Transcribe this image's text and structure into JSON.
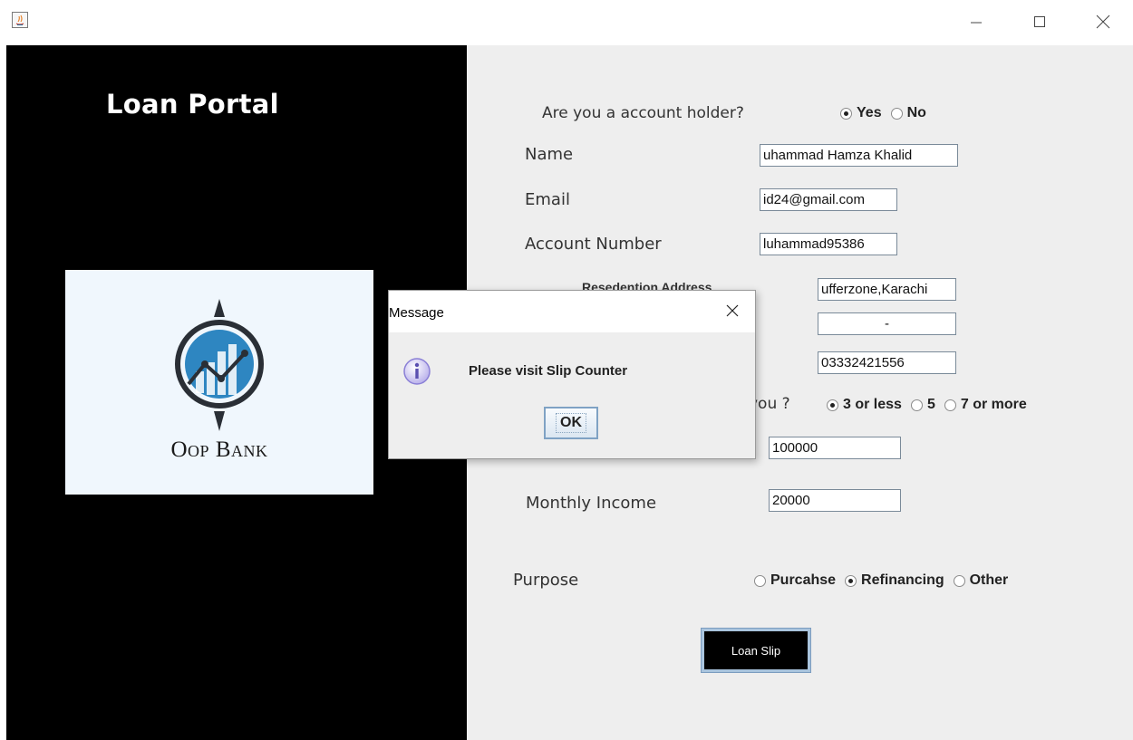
{
  "window": {
    "minimize_icon": "minimize-icon",
    "maximize_icon": "maximize-icon",
    "close_icon": "close-icon"
  },
  "brand": {
    "title": "Loan Portal",
    "logo_text": "Oop Bank",
    "logo_colors": [
      "#2a2f36",
      "#2e86c1",
      "#5fb0e5"
    ]
  },
  "form": {
    "account_holder": {
      "question": "Are you a account holder?",
      "options": [
        {
          "label": "Yes",
          "selected": true
        },
        {
          "label": "No",
          "selected": false
        }
      ]
    },
    "name": {
      "label": "Name",
      "value": "uhammad Hamza Khalid"
    },
    "email": {
      "label": "Email",
      "value": "id24@gmail.com"
    },
    "account_number": {
      "label": "Account Number",
      "value": "luhammad95386"
    },
    "residence": {
      "label": "Resedention Address",
      "value": "ufferzone,Karachi"
    },
    "blank_field": {
      "value": "-"
    },
    "phone": {
      "value": "03332421556"
    },
    "dependents": {
      "question_fragment": "you ?",
      "options": [
        {
          "label": "3 or less",
          "selected": true
        },
        {
          "label": "5",
          "selected": false
        },
        {
          "label": "7 or more",
          "selected": false
        }
      ]
    },
    "loan_amount": {
      "value": "100000"
    },
    "monthly_income": {
      "label": "Monthly Income",
      "value": "20000"
    },
    "purpose": {
      "label": "Purpose",
      "options": [
        {
          "label": "Purcahse",
          "selected": false
        },
        {
          "label": "Refinancing",
          "selected": true
        },
        {
          "label": "Other",
          "selected": false
        }
      ]
    },
    "submit_label": "Loan Slip"
  },
  "dialog": {
    "title": "Message",
    "message": "Please visit Slip Counter",
    "ok_label": "OK",
    "icon": "info-icon",
    "accent": "#8a7fd6"
  }
}
